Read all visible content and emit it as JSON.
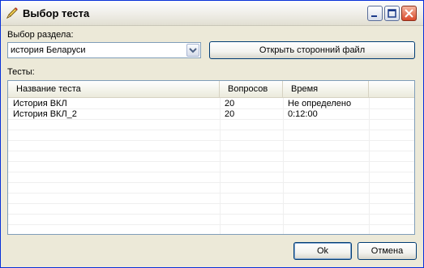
{
  "window": {
    "title": "Выбор теста"
  },
  "section": {
    "label": "Выбор раздела:",
    "selected": "история Беларуси",
    "open_file_button": "Открыть сторонний файл"
  },
  "tests": {
    "label": "Тесты:",
    "columns": [
      "Название теста",
      "Вопросов",
      "Время"
    ],
    "rows": [
      [
        "История ВКЛ",
        "20",
        "Не определено"
      ],
      [
        "История ВКЛ_2",
        "20",
        "0:12:00"
      ]
    ]
  },
  "footer": {
    "ok": "Ok",
    "cancel": "Отмена"
  }
}
